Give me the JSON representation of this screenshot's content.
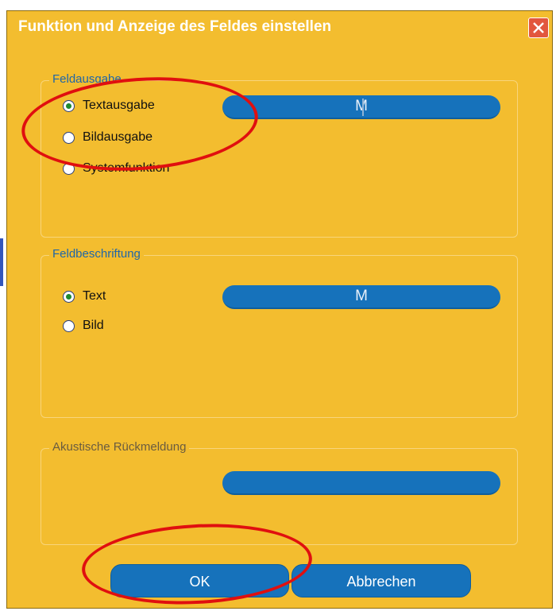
{
  "dialog": {
    "title": "Funktion und Anzeige des Feldes einstellen"
  },
  "groups": {
    "field_output": {
      "legend": "Feldausgabe",
      "options": [
        {
          "label": "Textausgabe",
          "checked": true
        },
        {
          "label": "Bildausgabe",
          "checked": false
        },
        {
          "label": "Systemfunktion",
          "checked": false
        }
      ],
      "value": "M"
    },
    "field_caption": {
      "legend": "Feldbeschriftung",
      "options": [
        {
          "label": "Text",
          "checked": true
        },
        {
          "label": "Bild",
          "checked": false
        }
      ],
      "value": "M"
    },
    "acoustic_feedback": {
      "legend": "Akustische Rückmeldung",
      "value": ""
    }
  },
  "buttons": {
    "ok": "OK",
    "cancel": "Abbrechen"
  },
  "colors": {
    "dialog_background": "#f3bd2f",
    "control_blue": "#1672bb",
    "annotation_red": "#e00f0f"
  },
  "icons": {
    "close": "close-icon"
  }
}
